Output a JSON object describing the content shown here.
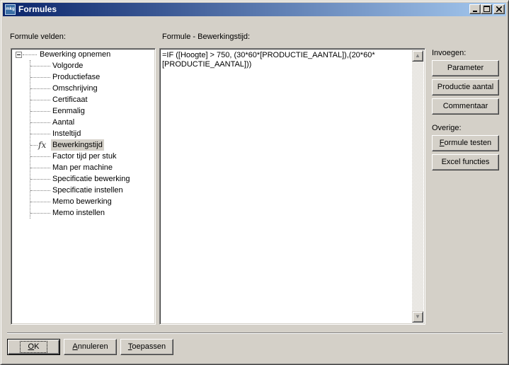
{
  "window": {
    "title": "Formules",
    "app_icon_text": "mkg"
  },
  "left_panel": {
    "label": "Formule velden:",
    "tree_root": "Bewerking opnemen",
    "tree_items": [
      "Volgorde",
      "Productiefase",
      "Omschrijving",
      "Certificaat",
      "Eenmalig",
      "Aantal",
      "Insteltijd",
      "Bewerkingstijd",
      "Factor tijd per stuk",
      "Man per machine",
      "Specificatie bewerking",
      "Specificatie instellen",
      "Memo bewerking",
      "Memo instellen"
    ],
    "selected_item": "Bewerkingstijd",
    "selected_icon": "fx"
  },
  "editor": {
    "label": "Formule - Bewerkingstijd:",
    "formula": "=IF ([Hoogte] > 750, (30*60*[PRODUCTIE_AANTAL]),(20*60*[PRODUCTIE_AANTAL]))"
  },
  "right_panel": {
    "insert_label": "Invoegen:",
    "insert_buttons": [
      "Parameter",
      "Productie aantal",
      "Commentaar"
    ],
    "other_label": "Overige:",
    "other_buttons": [
      "Formule testen",
      "Excel functies"
    ]
  },
  "footer": {
    "ok": "OK",
    "cancel": "Annuleren",
    "apply": "Toepassen"
  }
}
